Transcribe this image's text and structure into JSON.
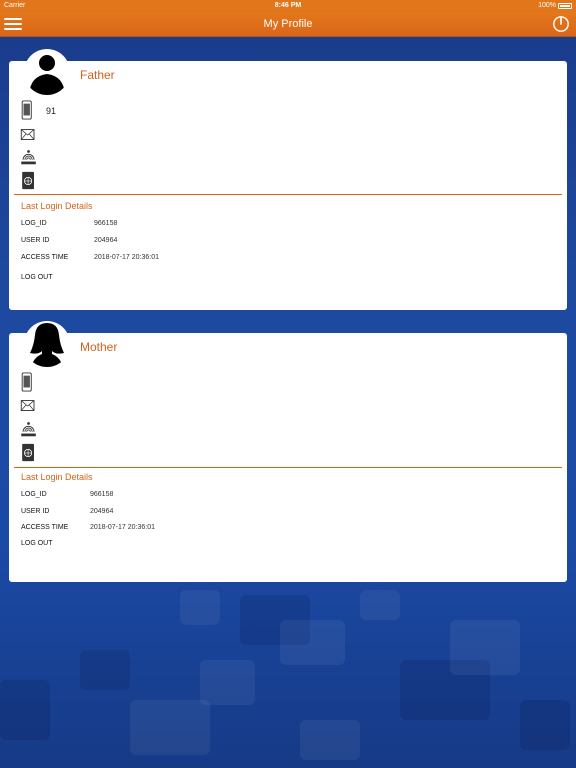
{
  "status_bar": {
    "carrier": "Carrier",
    "time": "8:46 PM",
    "battery": "100%"
  },
  "nav": {
    "title": "My Profile",
    "menu_icon": "hamburger-menu-icon",
    "power_icon": "power-icon"
  },
  "colors": {
    "accent": "#d2631c",
    "nav_bar": "#e2761a",
    "background": "#1b4aa6"
  },
  "profiles": [
    {
      "name": "Father",
      "phone": "91",
      "email": "",
      "aadhaar": "",
      "passport": "",
      "login_section_title": "Last Login Details",
      "log_id_label": "LOG_ID",
      "log_id": "966158",
      "user_id_label": "USER ID",
      "user_id": "204964",
      "access_time_label": "ACCESS TIME",
      "access_time": "2018-07-17 20:36:01",
      "logout_label": "LOG OUT"
    },
    {
      "name": "Mother",
      "phone": "",
      "email": "",
      "aadhaar": "",
      "passport": "",
      "login_section_title": "Last Login Details",
      "log_id_label": "LOG_ID",
      "log_id": "966158",
      "user_id_label": "USER ID",
      "user_id": "204964",
      "access_time_label": "ACCESS TIME",
      "access_time": "2018-07-17 20:36:01",
      "logout_label": "LOG OUT"
    }
  ]
}
